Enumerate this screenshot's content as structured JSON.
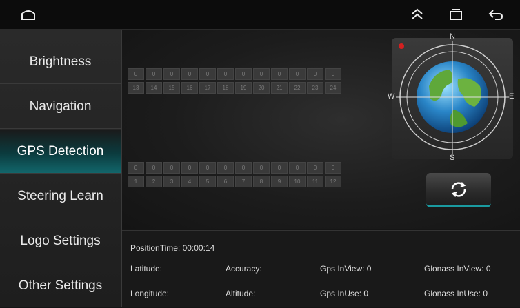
{
  "topbar": {
    "home_icon": "home-icon",
    "collapse_icon": "double-chevron-up-icon",
    "recents_icon": "recent-apps-icon",
    "back_icon": "back-arrow-icon"
  },
  "sidebar": {
    "items": [
      {
        "label": "Brightness"
      },
      {
        "label": "Navigation"
      },
      {
        "label": "GPS Detection"
      },
      {
        "label": "Steering Learn"
      },
      {
        "label": "Logo Settings"
      },
      {
        "label": "Other Settings"
      }
    ],
    "active_index": 2
  },
  "satellites_upper": {
    "values": [
      "0",
      "0",
      "0",
      "0",
      "0",
      "0",
      "0",
      "0",
      "0",
      "0",
      "0",
      "0"
    ],
    "ids": [
      "13",
      "14",
      "15",
      "16",
      "17",
      "18",
      "19",
      "20",
      "21",
      "22",
      "23",
      "24"
    ]
  },
  "satellites_lower": {
    "values": [
      "0",
      "0",
      "0",
      "0",
      "0",
      "0",
      "0",
      "0",
      "0",
      "0",
      "0",
      "0"
    ],
    "ids": [
      "1",
      "2",
      "3",
      "4",
      "5",
      "6",
      "7",
      "8",
      "9",
      "10",
      "11",
      "12"
    ]
  },
  "compass": {
    "n": "N",
    "s": "S",
    "e": "E",
    "w": "W"
  },
  "info": {
    "position_time": "PositionTime: 00:00:14",
    "latitude": "Latitude:",
    "longitude": "Longitude:",
    "accuracy": "Accuracy:",
    "altitude": "Altitude:",
    "gps_inview": "Gps InView: 0",
    "gps_inuse": "Gps InUse: 0",
    "glonass_inview": "Glonass InView: 0",
    "glonass_inuse": "Glonass InUse: 0"
  },
  "colors": {
    "accent": "#12666b",
    "highlight": "#1a9aa0"
  }
}
